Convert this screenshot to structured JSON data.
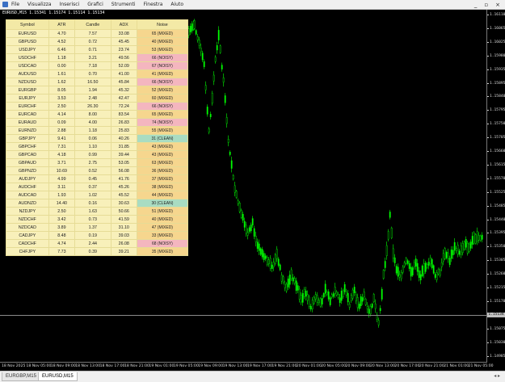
{
  "menu": {
    "items": [
      "File",
      "Visualizza",
      "Inserisci",
      "Grafici",
      "Strumenti",
      "Finestra",
      "Aiuto"
    ],
    "window_controls": {
      "minimize": "_",
      "restore": "▫",
      "close": "×"
    }
  },
  "chart": {
    "header": "EURUSD,M15  1.15341 1.15174 1.15114 1.15134",
    "candle_color": "#00ff00",
    "background": "#000000",
    "current_price": "1.15134",
    "price_labels": [
      "1.16110",
      "1.16065",
      "1.16025",
      "1.15980",
      "1.15935",
      "1.15895",
      "1.15840",
      "1.15795",
      "1.15750",
      "1.15705",
      "1.15660",
      "1.15615",
      "1.15570",
      "1.15525",
      "1.15485",
      "1.15440",
      "1.15395",
      "1.15350",
      "1.15305",
      "1.15260",
      "1.15215",
      "1.15170",
      "1.15125",
      "1.15075",
      "1.15030",
      "1.14985"
    ],
    "time_labels": [
      "18 Nov 2025",
      "18 Nov 05:00",
      "18 Nov 09:00",
      "18 Nov 13:00",
      "18 Nov 17:00",
      "18 Nov 21:00",
      "19 Nov 01:00",
      "19 Nov 05:00",
      "19 Nov 09:00",
      "19 Nov 13:00",
      "19 Nov 17:00",
      "19 Nov 21:00",
      "20 Nov 01:00",
      "20 Nov 05:00",
      "20 Nov 09:00",
      "20 Nov 13:00",
      "20 Nov 17:00",
      "20 Nov 21:00",
      "21 Nov 01:00",
      "21 Nov 05:00"
    ]
  },
  "scanner": {
    "headers": [
      "Symbol",
      "ATR",
      "Candle",
      "ADX",
      "Noise"
    ],
    "rows": [
      {
        "symbol": "EURUSD",
        "atr": "4.70",
        "candle": "7.57",
        "adx": "33.08",
        "noise": "65 (MIXED)",
        "cls": "mixed"
      },
      {
        "symbol": "GBPUSD",
        "atr": "4.52",
        "candle": "0.72",
        "adx": "45.45",
        "noise": "40 (MIXED)",
        "cls": "mixed"
      },
      {
        "symbol": "USDJPY",
        "atr": "6.46",
        "candle": "0.71",
        "adx": "23.74",
        "noise": "53 (MIXED)",
        "cls": "mixed"
      },
      {
        "symbol": "USDCHF",
        "atr": "1.18",
        "candle": "3.21",
        "adx": "49.56",
        "noise": "66 (NOISY)",
        "cls": "noisy"
      },
      {
        "symbol": "USDCAD",
        "atr": "0.00",
        "candle": "7.18",
        "adx": "52.09",
        "noise": "67 (NOISY)",
        "cls": "noisy"
      },
      {
        "symbol": "AUDUSD",
        "atr": "1.61",
        "candle": "0.70",
        "adx": "41.00",
        "noise": "41 (MIXED)",
        "cls": "mixed"
      },
      {
        "symbol": "NZDUSD",
        "atr": "1.62",
        "candle": "16.50",
        "adx": "45.84",
        "noise": "66 (NOISY)",
        "cls": "noisy"
      },
      {
        "symbol": "EURGBP",
        "atr": "8.05",
        "candle": "1.94",
        "adx": "45.32",
        "noise": "52 (MIXED)",
        "cls": "mixed"
      },
      {
        "symbol": "EURJPY",
        "atr": "3.53",
        "candle": "2.48",
        "adx": "42.47",
        "noise": "60 (MIXED)",
        "cls": "mixed"
      },
      {
        "symbol": "EURCHF",
        "atr": "2.50",
        "candle": "26.30",
        "adx": "72.24",
        "noise": "66 (NOISY)",
        "cls": "noisy"
      },
      {
        "symbol": "EURCAD",
        "atr": "4.14",
        "candle": "8.00",
        "adx": "83.54",
        "noise": "65 (MIXED)",
        "cls": "mixed"
      },
      {
        "symbol": "EURAUD",
        "atr": "0.09",
        "candle": "4.00",
        "adx": "26.83",
        "noise": "74 (NOISY)",
        "cls": "noisy"
      },
      {
        "symbol": "EURNZD",
        "atr": "2.88",
        "candle": "1.18",
        "adx": "25.83",
        "noise": "55 (MIXED)",
        "cls": "mixed"
      },
      {
        "symbol": "GBPJPY",
        "atr": "9.41",
        "candle": "0.06",
        "adx": "40.26",
        "noise": "31 (CLEAN)",
        "cls": "clean"
      },
      {
        "symbol": "GBPCHF",
        "atr": "7.31",
        "candle": "1.10",
        "adx": "31.85",
        "noise": "43 (MIXED)",
        "cls": "mixed"
      },
      {
        "symbol": "GBPCAD",
        "atr": "4.18",
        "candle": "0.99",
        "adx": "39.44",
        "noise": "43 (MIXED)",
        "cls": "mixed"
      },
      {
        "symbol": "GBPAUD",
        "atr": "3.71",
        "candle": "2.75",
        "adx": "53.05",
        "noise": "63 (MIXED)",
        "cls": "mixed"
      },
      {
        "symbol": "GBPNZD",
        "atr": "10.69",
        "candle": "0.52",
        "adx": "56.08",
        "noise": "36 (MIXED)",
        "cls": "mixed"
      },
      {
        "symbol": "AUDJPY",
        "atr": "4.99",
        "candle": "0.45",
        "adx": "41.76",
        "noise": "37 (MIXED)",
        "cls": "mixed"
      },
      {
        "symbol": "AUDCHF",
        "atr": "3.11",
        "candle": "0.37",
        "adx": "45.26",
        "noise": "38 (MIXED)",
        "cls": "mixed"
      },
      {
        "symbol": "AUDCAD",
        "atr": "1.93",
        "candle": "1.02",
        "adx": "45.52",
        "noise": "44 (MIXED)",
        "cls": "mixed"
      },
      {
        "symbol": "AUDNZD",
        "atr": "14.40",
        "candle": "0.16",
        "adx": "30.63",
        "noise": "30 (CLEAN)",
        "cls": "clean"
      },
      {
        "symbol": "NZDJPY",
        "atr": "2.50",
        "candle": "1.63",
        "adx": "50.66",
        "noise": "51 (MIXED)",
        "cls": "mixed"
      },
      {
        "symbol": "NZDCHF",
        "atr": "3.42",
        "candle": "0.73",
        "adx": "41.59",
        "noise": "40 (MIXED)",
        "cls": "mixed"
      },
      {
        "symbol": "NZDCAD",
        "atr": "3.89",
        "candle": "1.37",
        "adx": "31.10",
        "noise": "47 (MIXED)",
        "cls": "mixed"
      },
      {
        "symbol": "CADJPY",
        "atr": "8.48",
        "candle": "0.19",
        "adx": "39.03",
        "noise": "33 (MIXED)",
        "cls": "mixed"
      },
      {
        "symbol": "CADCHF",
        "atr": "4.74",
        "candle": "2.44",
        "adx": "26.08",
        "noise": "68 (NOISY)",
        "cls": "noisy"
      },
      {
        "symbol": "CHFJPY",
        "atr": "7.73",
        "candle": "0.39",
        "adx": "39.21",
        "noise": "35 (MIXED)",
        "cls": "mixed"
      }
    ]
  },
  "tabs": [
    {
      "label": "EURGBP,M15",
      "active": false
    },
    {
      "label": "EURUSD,M15",
      "active": true
    }
  ],
  "tab_nav": "◂ ▸"
}
